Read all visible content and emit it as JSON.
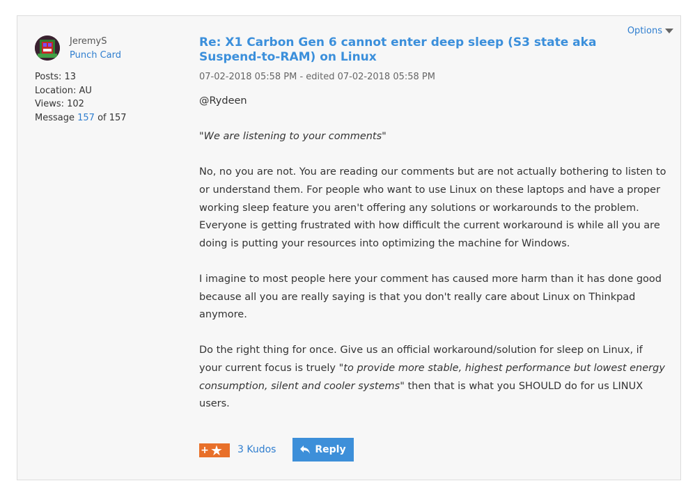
{
  "author": {
    "name": "JeremyS",
    "rank": "Punch Card",
    "posts_label": "Posts: 13",
    "location_label": "Location: AU",
    "views_label": "Views: 102",
    "message_prefix": "Message ",
    "message_number": "157",
    "message_suffix": " of 157"
  },
  "post": {
    "options_label": "Options",
    "title": "Re: X1 Carbon Gen 6 cannot enter deep sleep (S3 state aka Suspend-to-RAM) on Linux",
    "meta": "07-02-2018 05:58 PM - edited 07-02-2018 05:58 PM",
    "mention": "@Rydeen",
    "quote": "\"We are listening to your comments\"",
    "para1": "No, no you are not. You are reading our comments but are not actually bothering to listen to or understand them. For people who want to use Linux on these laptops and have a proper working sleep feature you aren't offering any solutions or workarounds to the problem. Everyone is getting frustrated with how difficult the current workaround is while all you are doing is putting your resources into optimizing the machine for Windows.",
    "para2": "I imagine to most people here your comment has caused more harm than it has done good because all you are really saying is that you don't really care about Linux on Thinkpad anymore.",
    "para3_start": "Do the right thing for once. Give us an official workaround/solution for sleep on Linux, if your current focus is truely \"",
    "para3_em": "to provide more stable, highest performance but lowest energy consumption,  silent and cooler systems",
    "para3_end": "\" then that is what you SHOULD do for us LINUX users."
  },
  "actions": {
    "kudos_plus": "+",
    "kudos_count": "3 Kudos",
    "reply_label": "Reply"
  },
  "colors": {
    "accent": "#3d8fd9",
    "kudo": "#e8702a",
    "link": "#2f7ecf"
  },
  "icons": {
    "kudo": "star-icon",
    "reply": "reply-arrow-icon",
    "options": "caret-down-icon"
  }
}
